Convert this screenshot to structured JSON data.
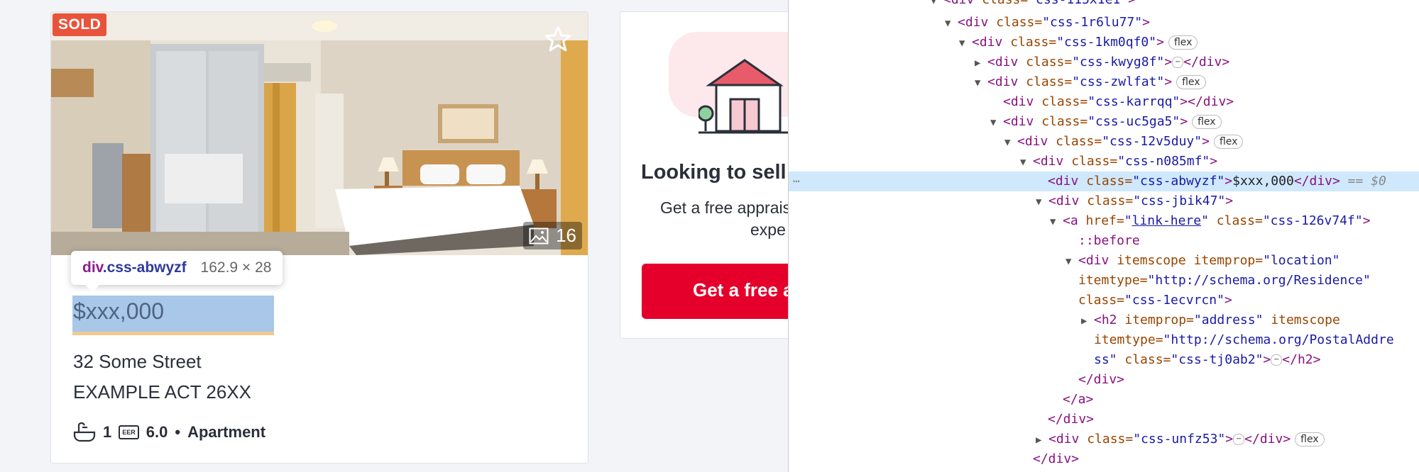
{
  "listing": {
    "badge": "SOLD",
    "photo_count": "16",
    "tooltip": {
      "tag": "div",
      "class": ".css-abwyzf",
      "size": "162.9 × 28"
    },
    "price": "$xxx,000",
    "address_line1": "32 Some Street",
    "address_line2": "EXAMPLE ACT 26XX",
    "bathrooms": "1",
    "eer_badge": "EER",
    "eer": "6.0",
    "separator": "•",
    "property_type": "Apartment",
    "icons": [
      "star-icon",
      "image-icon",
      "bath-icon",
      "eer-icon"
    ]
  },
  "appraisal": {
    "title": "Looking to sell",
    "subtitle1": "Get a free apprais",
    "subtitle2": "expe",
    "button": "Get a free a"
  },
  "devtools": {
    "l0_tag": "<div",
    "l0_attr": " class=",
    "l0_val": "\"css-115x1e1\"",
    "l0_end": ">",
    "l1_tag": "<div",
    "l1_attr": " class=",
    "l1_val": "\"css-1r6lu77\"",
    "l1_end": ">",
    "l2_tag": "<div",
    "l2_attr": " class=",
    "l2_val": "\"css-1km0qf0\"",
    "l2_end": ">",
    "l2_pill": "flex",
    "l3_tag": "<div",
    "l3_attr": " class=",
    "l3_val": "\"css-kwyg8f\"",
    "l3_end": ">",
    "l3_dots": "⋯",
    "l3_close": "</div>",
    "l4_tag": "<div",
    "l4_attr": " class=",
    "l4_val": "\"css-zwlfat\"",
    "l4_end": ">",
    "l4_pill": "flex",
    "l5_tag": "<div",
    "l5_attr": " class=",
    "l5_val": "\"css-karrqq\"",
    "l5_end": "></div>",
    "l6_tag": "<div",
    "l6_attr": " class=",
    "l6_val": "\"css-uc5ga5\"",
    "l6_end": ">",
    "l6_pill": "flex",
    "l7_tag": "<div",
    "l7_attr": " class=",
    "l7_val": "\"css-12v5duy\"",
    "l7_end": ">",
    "l7_pill": "flex",
    "l8_tag": "<div",
    "l8_attr": " class=",
    "l8_val": "\"css-n085mf\"",
    "l8_end": ">",
    "l9_gutter": "⋯",
    "l9_tag": "<div",
    "l9_attr": " class=",
    "l9_val": "\"css-abwyzf\"",
    "l9_end": ">",
    "l9_text": "$xxx,000",
    "l9_close": "</div>",
    "l9_eq": " == $0",
    "l10_tag": "<div",
    "l10_attr": " class=",
    "l10_val": "\"css-jbik47\"",
    "l10_end": ">",
    "l11_tag": "<a",
    "l11_attr1": " href=",
    "l11_q1": "\"",
    "l11_link": "link-here",
    "l11_q2": "\"",
    "l11_attr2": " class=",
    "l11_val2": "\"css-126v74f\"",
    "l11_end": ">",
    "l12_pseudo": "::before",
    "l13_tag": "<div",
    "l13_attr1": " itemscope",
    "l13_attr2": " itemprop=",
    "l13_val2": "\"location\"",
    "l14_attr": "itemtype=",
    "l14_val": "\"http://schema.org/Residence\"",
    "l15_attr": "class=",
    "l15_val": "\"css-1ecvrcn\"",
    "l15_end": ">",
    "l16_tag": "<h2",
    "l16_attr1": " itemprop=",
    "l16_val1": "\"address\"",
    "l16_attr2": " itemscope",
    "l17_attr": "itemtype=",
    "l17_val": "\"http://schema.org/PostalAddre",
    "l18_val": "ss\"",
    "l18_attr": " class=",
    "l18_val2": "\"css-tj0ab2\"",
    "l18_end": ">",
    "l18_dots": "⋯",
    "l18_close": "</h2>",
    "l19_close": "</div>",
    "l20_close": "</a>",
    "l21_close": "</div>",
    "l22_tag": "<div",
    "l22_attr": " class=",
    "l22_val": "\"css-unfz53\"",
    "l22_end": ">",
    "l22_dots": "⋯",
    "l22_close": "</div>",
    "l22_pill": "flex",
    "l23_close": "</div>"
  },
  "colors": {
    "sold_badge": "#e8533b",
    "cta": "#e4002b",
    "selection": "#cfe8fc"
  }
}
